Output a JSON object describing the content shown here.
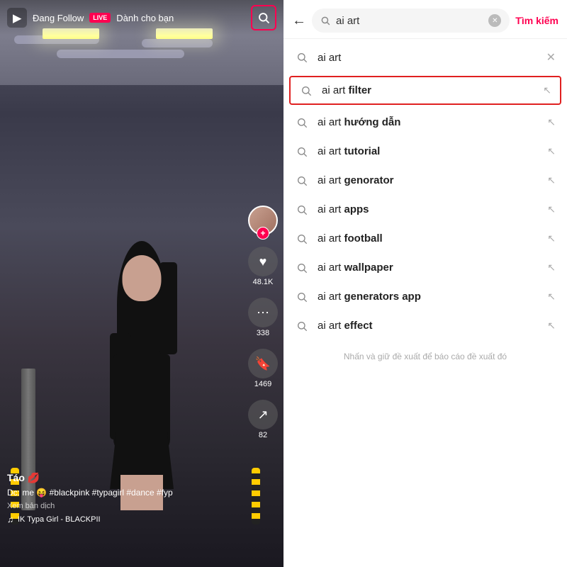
{
  "left": {
    "nav": {
      "follow_text": "Đang Follow",
      "live_text": "LIVE",
      "for_you": "Dành cho bạn"
    },
    "video": {
      "username": "Táo 💋",
      "caption": "Dc: me 😝 #blackpink #typagirl #dance\n#fyp",
      "translate": "Xem bản dịch",
      "music_note": "♫",
      "music_info": "IK   Typa Girl - BLACKPII",
      "like_count": "48.1K",
      "comment_count": "338",
      "bookmark_count": "1469",
      "share_count": "82"
    }
  },
  "right": {
    "search_value": "ai art",
    "search_placeholder": "ai art",
    "search_button": "Tìm kiếm",
    "results": [
      {
        "id": "ai-art",
        "text": "ai art",
        "bold": "",
        "type": "recent",
        "highlighted": false
      },
      {
        "id": "ai-art-filter",
        "text_prefix": "ai art ",
        "text_bold": "filter",
        "type": "suggestion",
        "highlighted": true
      },
      {
        "id": "ai-art-huong-dan",
        "text_prefix": "ai art ",
        "text_bold": "hướng dẫn",
        "type": "suggestion",
        "highlighted": false
      },
      {
        "id": "ai-art-tutorial",
        "text_prefix": "ai art ",
        "text_bold": "tutorial",
        "type": "suggestion",
        "highlighted": false
      },
      {
        "id": "ai-art-genorator",
        "text_prefix": "ai art ",
        "text_bold": "genorator",
        "type": "suggestion",
        "highlighted": false
      },
      {
        "id": "ai-art-apps",
        "text_prefix": "ai art ",
        "text_bold": "apps",
        "type": "suggestion",
        "highlighted": false
      },
      {
        "id": "ai-art-football",
        "text_prefix": "ai art ",
        "text_bold": "football",
        "type": "suggestion",
        "highlighted": false
      },
      {
        "id": "ai-art-wallpaper",
        "text_prefix": "ai art ",
        "text_bold": "wallpaper",
        "type": "suggestion",
        "highlighted": false
      },
      {
        "id": "ai-art-generators-app",
        "text_prefix": "ai art ",
        "text_bold": "generators app",
        "type": "suggestion",
        "highlighted": false
      },
      {
        "id": "ai-art-effect",
        "text_prefix": "ai art ",
        "text_bold": "effect",
        "type": "suggestion",
        "highlighted": false
      }
    ],
    "footer_hint": "Nhấn và giữ đề xuất để báo cáo đề xuất đó"
  }
}
